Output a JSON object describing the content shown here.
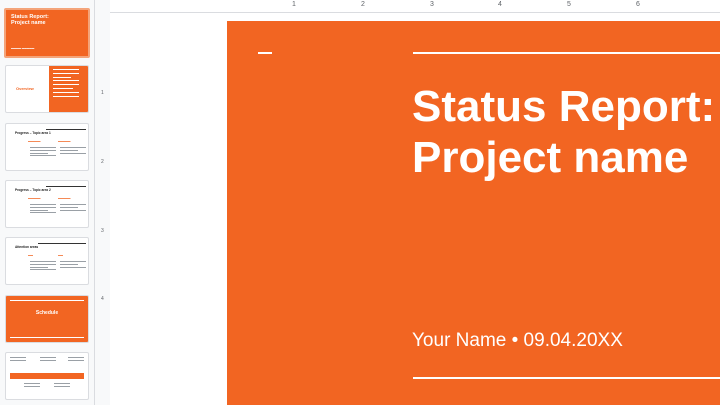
{
  "slide": {
    "title_line1": "Status Report:",
    "title_line2": "Project name",
    "byline": "Your Name • 09.04.20XX"
  },
  "filmstrip": {
    "s1": {
      "title": "Status Report: Project name"
    },
    "s2": {
      "label": "Overview"
    },
    "s3": {
      "heading": "Progress – Topic area 1"
    },
    "s4": {
      "heading": "Progress – Topic area 2"
    },
    "s5": {
      "heading": "Attention areas"
    },
    "s6": {
      "label": "Schedule"
    }
  },
  "ruler": {
    "top": [
      "1",
      "2",
      "3",
      "4",
      "5"
    ],
    "left": [
      "1",
      "2",
      "3",
      "4"
    ]
  },
  "colors": {
    "accent": "#f26522"
  }
}
